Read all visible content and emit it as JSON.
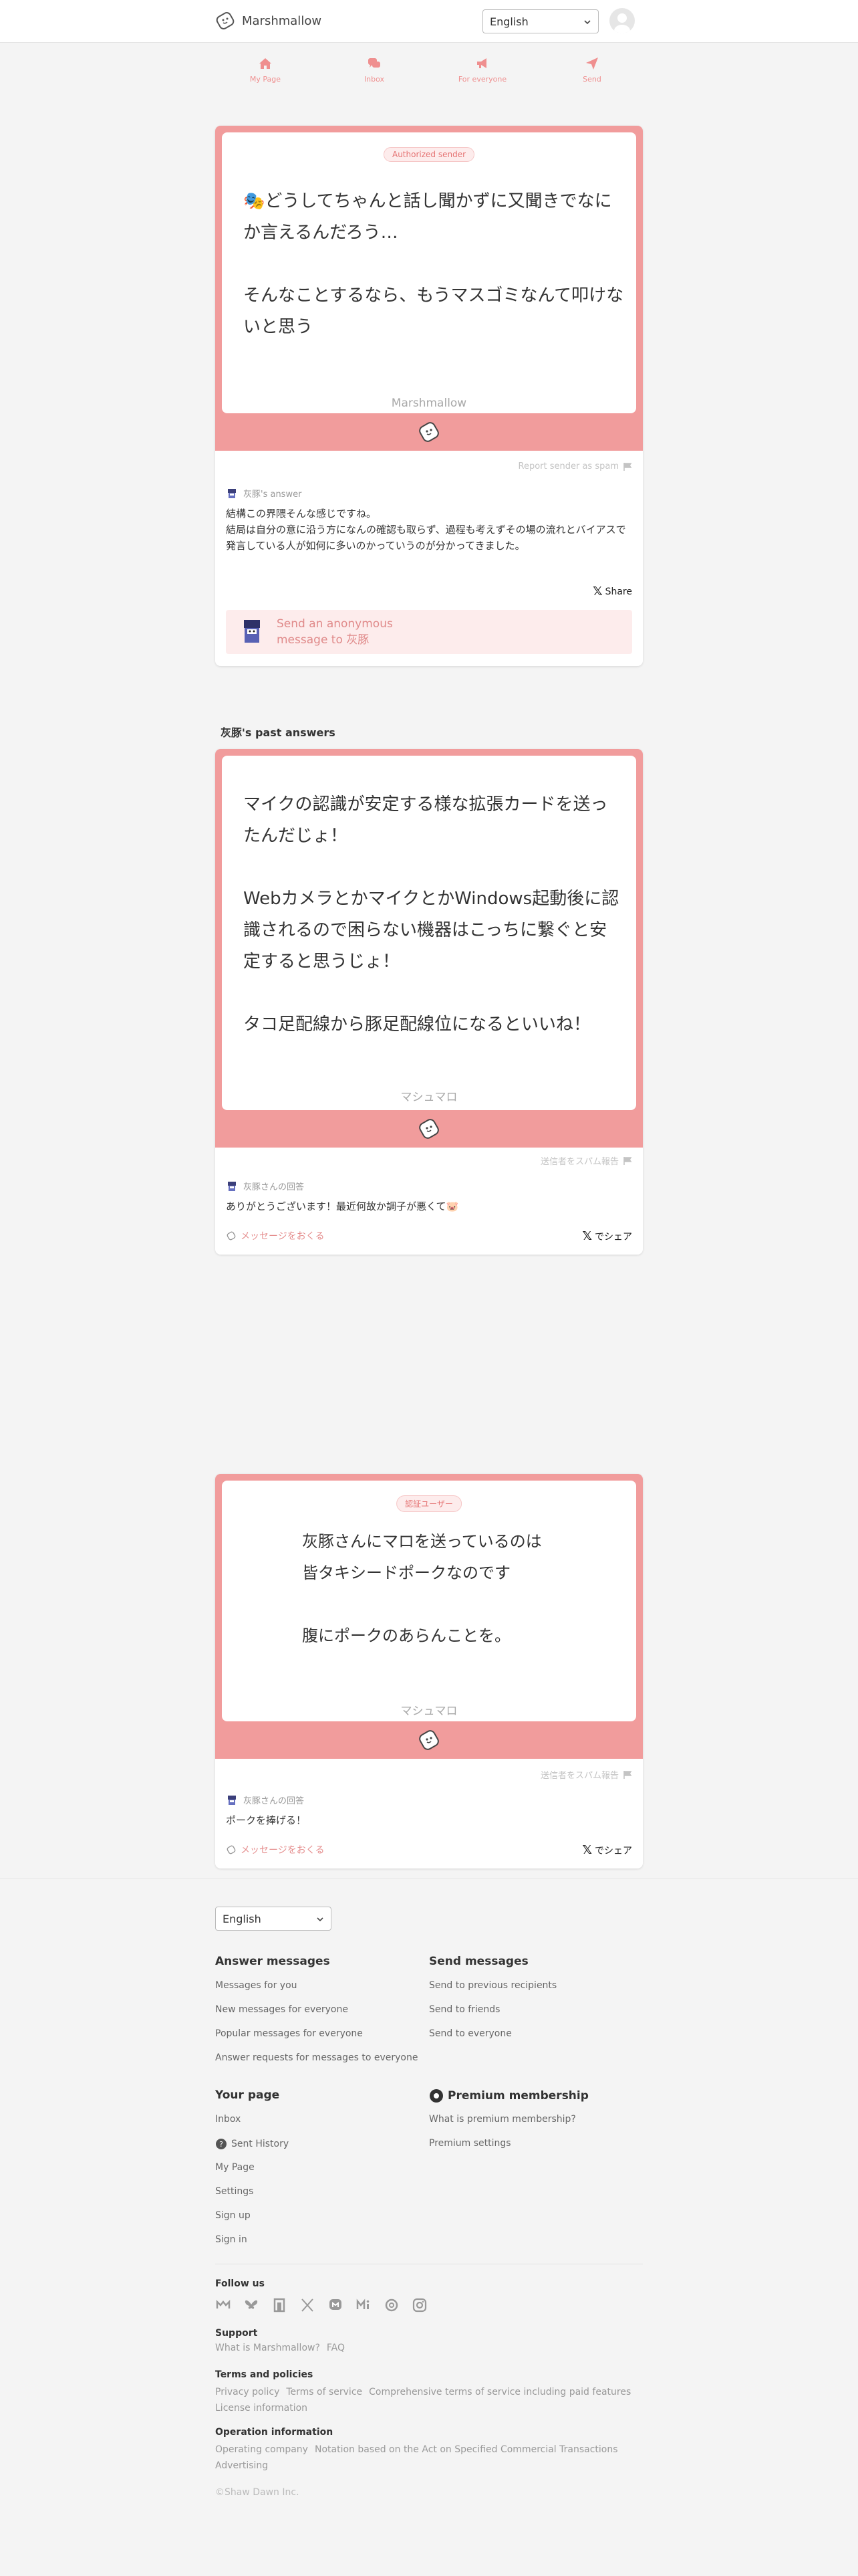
{
  "header": {
    "app_name": "Marshmallow",
    "language": "English"
  },
  "nav": [
    {
      "label": "My Page",
      "icon": "house-icon"
    },
    {
      "label": "Inbox",
      "icon": "chat-bubbles-icon"
    },
    {
      "label": "For everyone",
      "icon": "megaphone-icon"
    },
    {
      "label": "Send",
      "icon": "paper-plane-icon"
    }
  ],
  "featured": {
    "badge": "Authorized sender",
    "message": "🎭どうしてちゃんと話し聞かずに又聞きでなにか言えるんだろう…\n\nそんなことするなら、もうマスゴミなんて叩けないと思う",
    "signature": "Marshmallow",
    "report": "Report sender as spam",
    "answer_by": "灰豚's answer",
    "answer": "結構この界隈そんな感じですね。\n結局は自分の意に沿う方になんの確認も取らず、過程も考えずその場の流れとバイアスで\n発言している人が如何に多いのかっていうのが分かってきました。",
    "share": "Share",
    "send_label": "Send an anonymous message to 灰豚"
  },
  "past_title": "灰豚's past answers",
  "past": [
    {
      "message": "マイクの認識が安定する様な拡張カードを送ったんだじょ！\n\nWebカメラとかマイクとかWindows起動後に認識されるので困らない機器はこっちに繋ぐと安定すると思うじょ！\n\nタコ足配線から豚足配線位になるといいね！",
      "signature": "マシュマロ",
      "report": "送信者をスパム報告",
      "answer_by": "灰豚さんの回答",
      "answer": "ありがとうございます！最近何故か調子が悪くて🐷",
      "send": "メッセージをおくる",
      "share": "でシェア"
    },
    {
      "badge": "認証ユーザー",
      "message": "灰豚さんにマロを送っているのは\n皆タキシードポークなのです\n\n腹にポークのあらんことを。",
      "signature": "マシュマロ",
      "report": "送信者をスパム報告",
      "answer_by": "灰豚さんの回答",
      "answer": "ポークを捧げる！",
      "send": "メッセージをおくる",
      "share": "でシェア"
    }
  ],
  "footer": {
    "language": "English",
    "answer_messages": {
      "title": "Answer messages",
      "links": [
        "Messages for you",
        "New messages for everyone",
        "Popular messages for everyone",
        "Answer requests for messages to everyone"
      ]
    },
    "send_messages": {
      "title": "Send messages",
      "links": [
        "Send to previous recipients",
        "Send to friends",
        "Send to everyone"
      ]
    },
    "your_page": {
      "title": "Your page",
      "links": [
        "Inbox",
        "Sent History",
        "My Page",
        "Settings",
        "Sign up",
        "Sign in"
      ]
    },
    "premium": {
      "title": "Premium membership",
      "links": [
        "What is premium membership?",
        "Premium settings"
      ]
    },
    "follow_us": "Follow us",
    "support": {
      "title": "Support",
      "links": [
        "What is Marshmallow?",
        "FAQ"
      ]
    },
    "terms": {
      "title": "Terms and policies",
      "links": [
        "Privacy policy",
        "Terms of service",
        "Comprehensive terms of service including paid features",
        "License information"
      ]
    },
    "operation": {
      "title": "Operation information",
      "links": [
        "Operating company",
        "Notation based on the Act on Specified Commercial Transactions",
        "Advertising"
      ]
    },
    "copyright": "©Shaw Dawn Inc."
  },
  "colors": {
    "accent": "#f19c9c",
    "accent_light": "#fdecec",
    "background": "#f4f4f4"
  }
}
